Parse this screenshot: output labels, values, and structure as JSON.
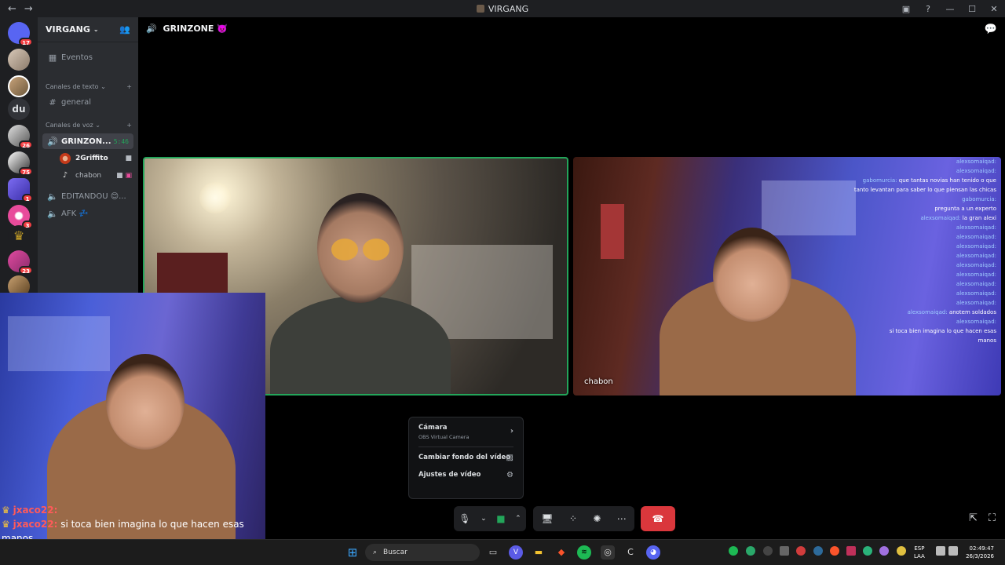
{
  "window": {
    "title": "VIRGANG"
  },
  "server_rail": {
    "badges": [
      "17",
      "26",
      "75",
      "1",
      "3",
      "23"
    ],
    "text_server": "du"
  },
  "sidebar": {
    "guild_name": "VIRGANG",
    "events_label": "Eventos",
    "text_category": "Canales de texto",
    "text_channels": [
      "general"
    ],
    "voice_category": "Canales de voz",
    "active_voice": {
      "name": "GRINZON...",
      "time": "5:46"
    },
    "voice_users": [
      {
        "name": "2Griffito"
      },
      {
        "name": "chabon"
      }
    ],
    "other_voice": [
      "EDITANDOU 😊...",
      "AFK 💤"
    ]
  },
  "main": {
    "channel_title": "GRINZONE 👿",
    "tile_label": "chabon"
  },
  "chat_overlay": {
    "lines": [
      {
        "name": "alexsomaiqad:",
        "text": ""
      },
      {
        "name": "alexsomaiqad:",
        "text": ""
      },
      {
        "name": "gabomurcia:",
        "text": "que tantas novias han tenido o que"
      },
      {
        "name": "",
        "text": "tanto levantan para saber lo que piensan las chicas"
      },
      {
        "name": "gabomurcia:",
        "text": ""
      },
      {
        "name": "",
        "text": "pregunta a un experto"
      },
      {
        "name": "alexsomaiqad:",
        "text": "la gran alexi"
      },
      {
        "name": "alexsomaiqad:",
        "text": ""
      },
      {
        "name": "alexsomaiqad:",
        "text": ""
      },
      {
        "name": "alexsomaiqad:",
        "text": ""
      },
      {
        "name": "alexsomaiqad:",
        "text": ""
      },
      {
        "name": "alexsomaiqad:",
        "text": ""
      },
      {
        "name": "alexsomaiqad:",
        "text": ""
      },
      {
        "name": "alexsomaiqad:",
        "text": ""
      },
      {
        "name": "alexsomaiqad:",
        "text": ""
      },
      {
        "name": "alexsomaiqad:",
        "text": ""
      },
      {
        "name": "alexsomaiqad:",
        "text": "anotem soldados"
      },
      {
        "name": "alexsomaiqad:",
        "text": ""
      },
      {
        "name": "",
        "text": ""
      },
      {
        "name": "",
        "text": ""
      },
      {
        "name": "",
        "text": ""
      },
      {
        "name": "",
        "text": "si toca bien imagina lo que hacen esas"
      },
      {
        "name": "",
        "text": "manos"
      }
    ]
  },
  "bottom_overlay": {
    "name_top": "jxaco22:",
    "name_bottom": "jxaco22:",
    "message": "si toca bien imagina lo que hacen esas",
    "message_cont": "manos"
  },
  "camera_menu": {
    "camera_label": "Cámara",
    "camera_device": "OBS Virtual Camera",
    "background_label": "Cambiar fondo del vídeo",
    "settings_label": "Ajustes de vídeo"
  },
  "taskbar": {
    "search_placeholder": "Buscar",
    "lang_top": "ESP",
    "lang_bottom": "LAA",
    "time": "02:49:47",
    "date": "26/3/2026"
  },
  "colors": {
    "accent_green": "#23a55a",
    "hangup_red": "#da373c",
    "badge_red": "#f23f43"
  }
}
